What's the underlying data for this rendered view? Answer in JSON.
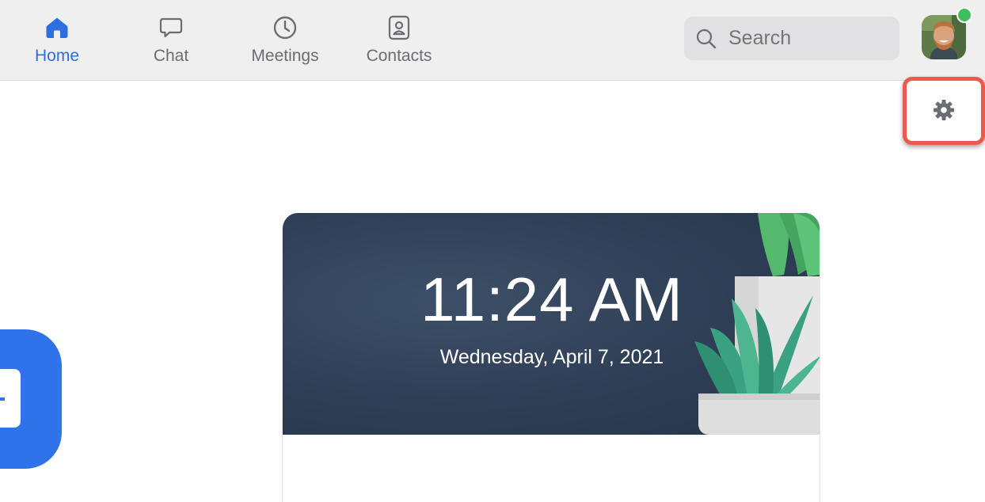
{
  "nav": {
    "tabs": [
      {
        "label": "Home",
        "icon": "home-icon",
        "active": true
      },
      {
        "label": "Chat",
        "icon": "chat-icon",
        "active": false
      },
      {
        "label": "Meetings",
        "icon": "clock-icon",
        "active": false
      },
      {
        "label": "Contacts",
        "icon": "contacts-icon",
        "active": false
      }
    ]
  },
  "search": {
    "placeholder": "Search",
    "icon": "search-icon"
  },
  "user": {
    "status": "online",
    "status_color": "#3bc05d"
  },
  "settings": {
    "icon": "gear-icon",
    "highlight_color": "#ea5a4f"
  },
  "clock": {
    "time": "11:24 AM",
    "date": "Wednesday, April 7, 2021"
  },
  "colors": {
    "accent": "#2d6ee0",
    "button_blue": "#2f73ea",
    "banner": "#2e3e55"
  }
}
